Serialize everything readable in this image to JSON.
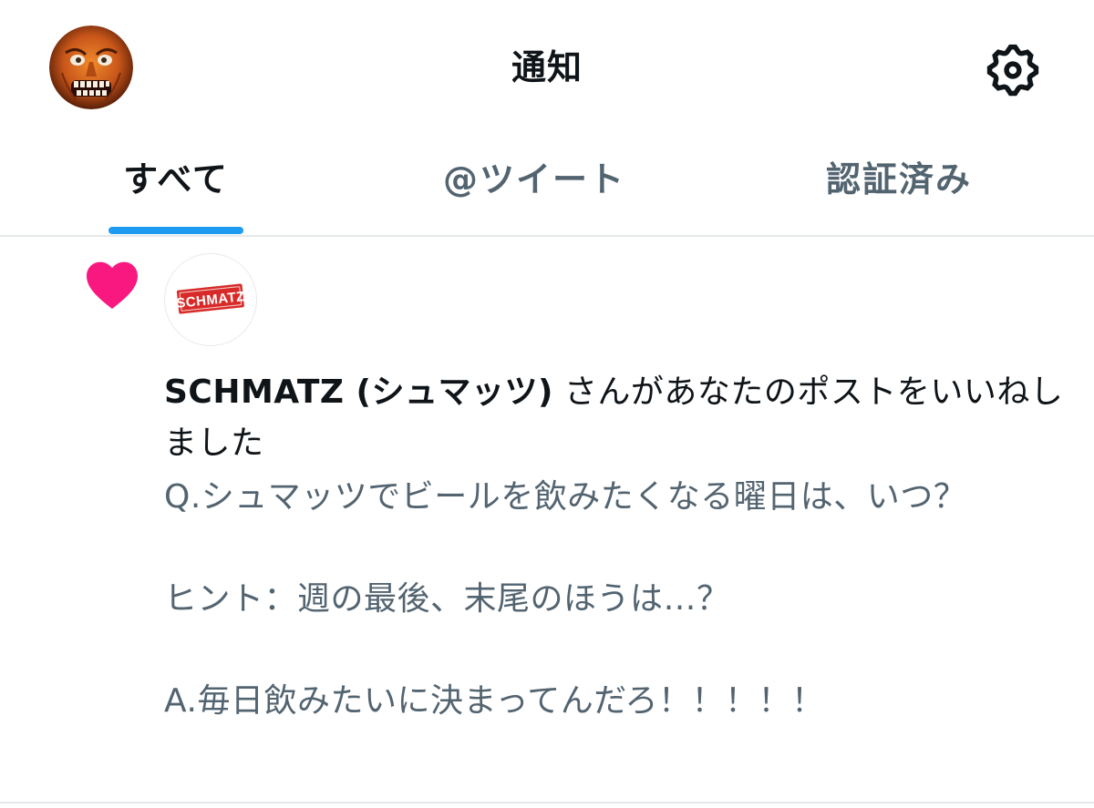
{
  "header": {
    "title": "通知",
    "avatar_icon": "user-avatar-icon",
    "settings_icon": "gear-icon"
  },
  "tabs": [
    {
      "label": "すべて",
      "active": true
    },
    {
      "label": "@ツイート",
      "active": false
    },
    {
      "label": "認証済み",
      "active": false
    }
  ],
  "notification": {
    "type_icon": "heart-icon",
    "type_color": "#f91880",
    "actor": {
      "name": "SCHMATZ (シュマッツ)",
      "logo_text": "SCHMATZ",
      "logo_color": "#d82b29"
    },
    "action_text": " さんがあなたのポストをいいねしました",
    "tweet_text": "Q.シュマッツでビールを飲みたくなる曜日は、いつ？\n\nヒント：週の最後、末尾のほうは…？\n\nA.毎日飲みたいに決まってんだろ！！！！！"
  },
  "colors": {
    "accent": "#1d9bf0",
    "text_primary": "#0f1419",
    "text_secondary": "#536471",
    "divider": "#e5e8ea"
  }
}
